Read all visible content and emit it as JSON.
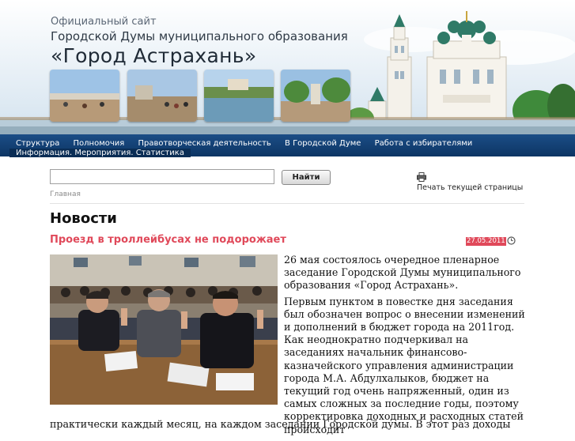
{
  "header": {
    "subtitle_small": "Официальный сайт",
    "subtitle_mid": "Городской Думы муниципального образования",
    "title": "«Город Астрахань»"
  },
  "nav": {
    "items": [
      "Структура",
      "Полномочия",
      "Правотворческая деятельность",
      "В Городской Думе",
      "Работа с избирателями"
    ],
    "item_second_row": "Информация. Мероприятия. Статистика"
  },
  "search": {
    "value": "",
    "placeholder": "",
    "button_label": "Найти"
  },
  "breadcrumb": "Главная",
  "print_label": "Печать текущей страницы",
  "page_title": "Новости",
  "article": {
    "title": "Проезд в троллейбусах не подорожает",
    "date": "27.05.2011",
    "paragraphs": [
      "26 мая состоялось очередное пленарное заседание Городской Думы муниципального образования «Город Астрахань».",
      "Первым пунктом в повестке дня заседания был обозначен вопрос о внесении изменений и дополнений в бюджет города на  2011год. Как неоднократно подчеркивал на заседаниях начальник финансово-казначейского управления администрации города М.А. Абдулхалыков, бюджет на текущий год очень напряженный, один из самых сложных за последние годы, поэтому корректировка доходных и расходных статей происходит"
    ],
    "continuation": "практически каждый месяц, на каждом заседании Городской думы. В этот раз доходы"
  },
  "colors": {
    "nav_bg": "#0d3564",
    "accent": "#e0495a"
  }
}
